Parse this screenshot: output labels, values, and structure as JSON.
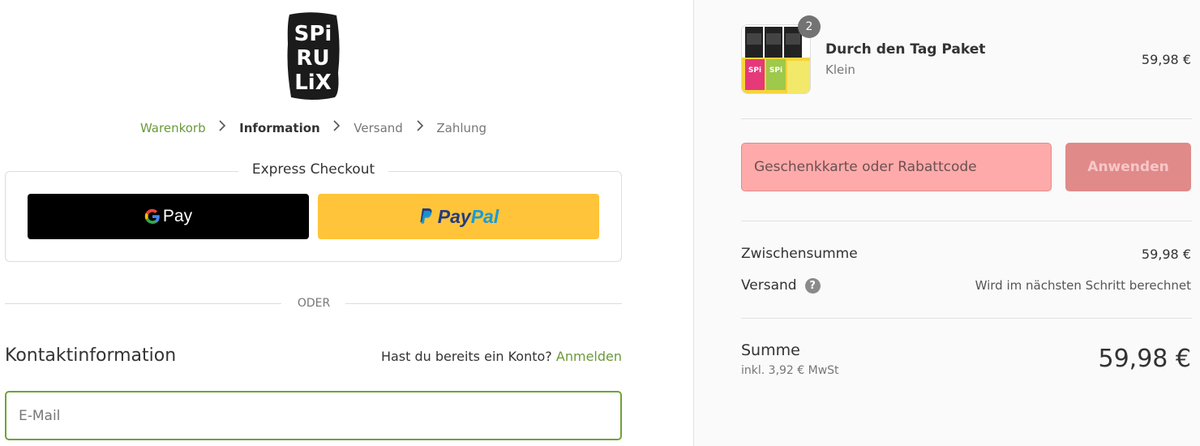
{
  "brand": {
    "logo_text": "SPIRULIX"
  },
  "breadcrumb": {
    "items": [
      {
        "label": "Warenkorb"
      },
      {
        "label": "Information"
      },
      {
        "label": "Versand"
      },
      {
        "label": "Zahlung"
      }
    ]
  },
  "express": {
    "title": "Express Checkout",
    "gpay_label": "Pay",
    "paypal_label_1": "Pay",
    "paypal_label_2": "Pal"
  },
  "divider": {
    "label": "ODER"
  },
  "contact": {
    "title": "Kontaktinformation",
    "account_prompt": "Hast du bereits ein Konto?",
    "login_link": "Anmelden",
    "email_placeholder": "E-Mail"
  },
  "order": {
    "product": {
      "name": "Durch den Tag Paket",
      "variant": "Klein",
      "price": "59,98 €",
      "quantity": "2"
    },
    "discount": {
      "placeholder": "Geschenkkarte oder Rabattcode",
      "apply_label": "Anwenden"
    },
    "subtotal_label": "Zwischensumme",
    "subtotal_value": "59,98 €",
    "shipping_label": "Versand",
    "shipping_value": "Wird im nächsten Schritt berechnet",
    "total_label": "Summe",
    "tax_note": "inkl. 3,92 € MwSt",
    "total_value": "59,98 €"
  },
  "colors": {
    "accent": "#6a9a3a",
    "paypal_yellow": "#ffc439",
    "discount_bg": "#ffaaaa"
  }
}
